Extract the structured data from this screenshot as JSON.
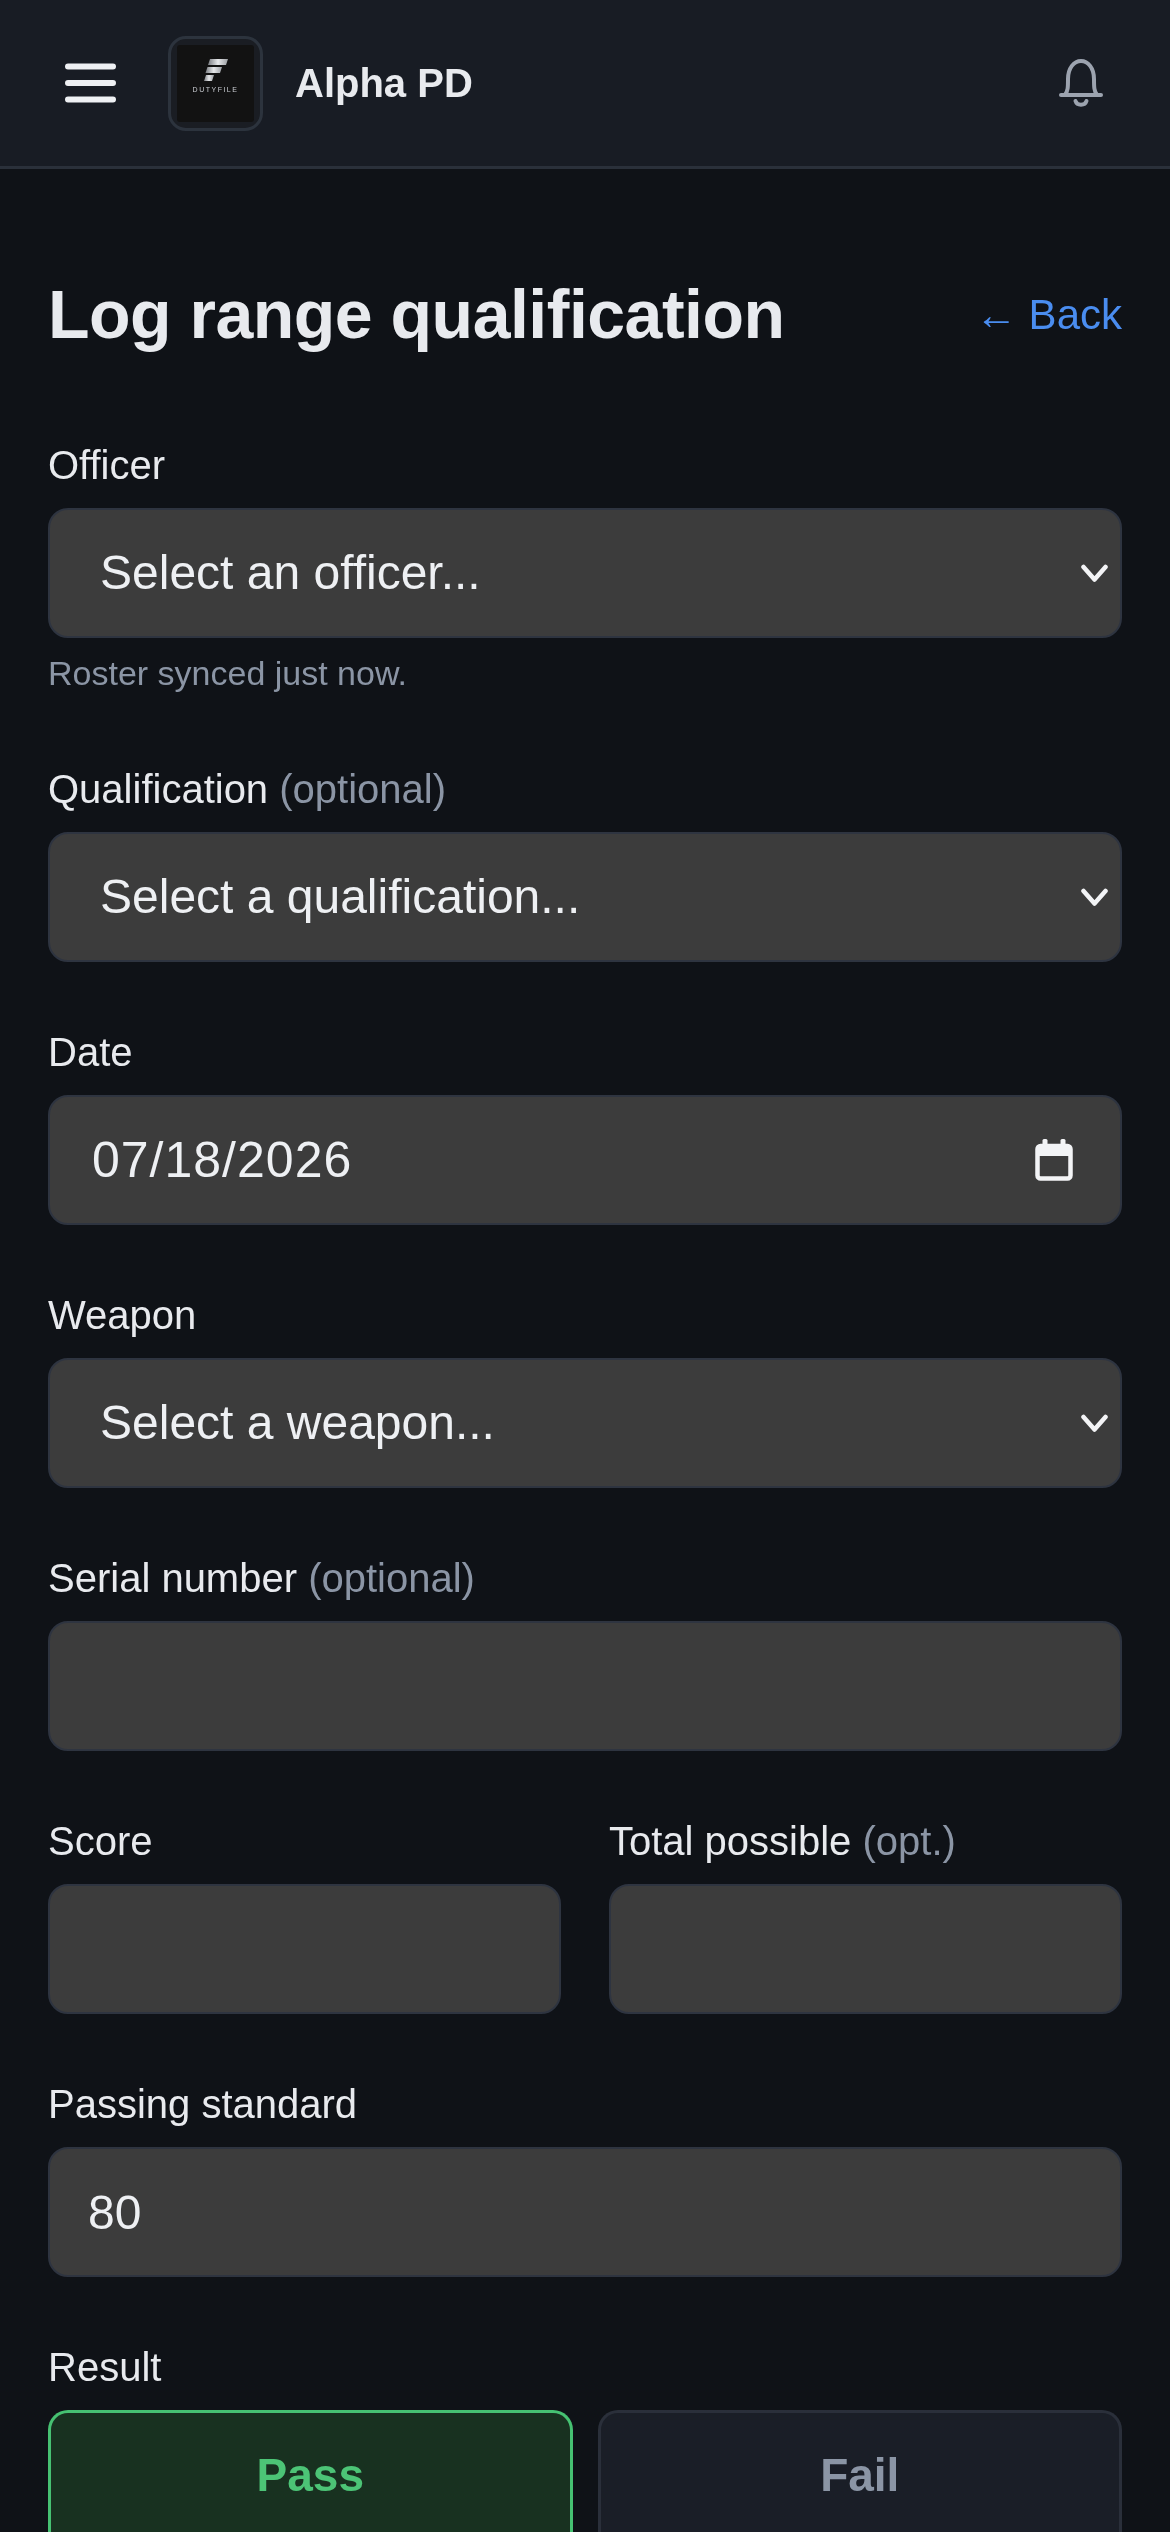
{
  "header": {
    "logo": {
      "wordmark": "DUTYFILE"
    },
    "title": "Alpha PD"
  },
  "page": {
    "title": "Log range qualification",
    "back_link": "← Back"
  },
  "form": {
    "rows": [
      {
        "fields": [
          {
            "kind": "select",
            "label": "Officer",
            "placeholder": "Select an officer...",
            "help": "Roster synced just now."
          }
        ]
      },
      {
        "fields": [
          {
            "kind": "select",
            "label": "Qualification",
            "label_note": "(optional)",
            "placeholder": "Select a qualification..."
          }
        ]
      },
      {
        "fields": [
          {
            "kind": "date",
            "label": "Date",
            "value": "07/18/2026"
          }
        ]
      },
      {
        "fields": [
          {
            "kind": "select",
            "label": "Weapon",
            "placeholder": "Select a weapon..."
          }
        ]
      },
      {
        "fields": [
          {
            "kind": "text",
            "label": "Serial number",
            "label_note": "(optional)"
          }
        ]
      },
      {
        "fields": [
          {
            "kind": "text",
            "label": "Score"
          },
          {
            "kind": "text",
            "label": "Total possible",
            "label_note": "(opt.)"
          }
        ]
      },
      {
        "fields": [
          {
            "kind": "text",
            "label": "Passing standard",
            "value": "80"
          }
        ]
      }
    ],
    "result": {
      "label": "Result",
      "options": [
        {
          "kind": "pass",
          "label": "Pass",
          "selected": true
        },
        {
          "kind": "fail",
          "label": "Fail",
          "selected": false
        }
      ]
    }
  }
}
